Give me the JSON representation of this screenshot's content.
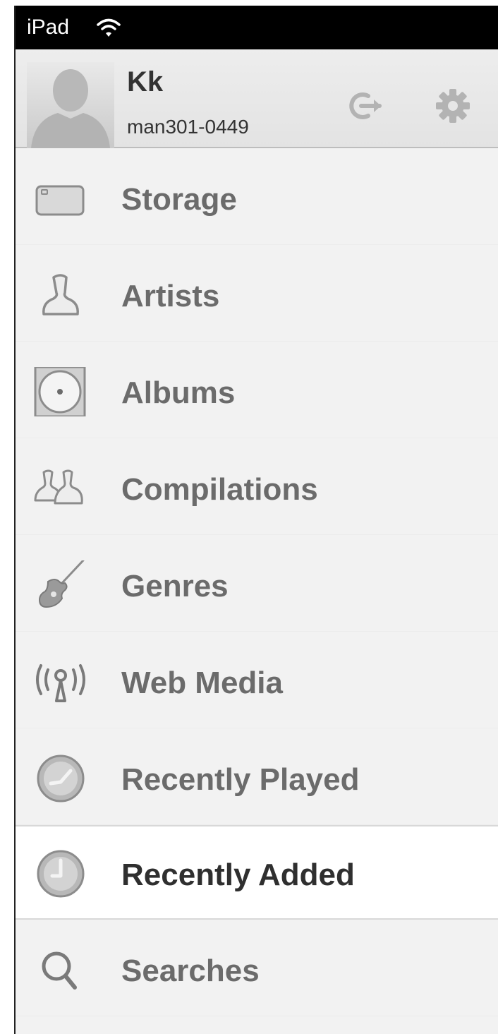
{
  "status_bar": {
    "device_name": "iPad",
    "wifi_icon": "wifi-icon"
  },
  "header": {
    "user_name": "Kk",
    "user_id": "man301-0449",
    "avatar_icon": "person-silhouette-icon",
    "logout_icon": "logout-arrow-icon",
    "settings_icon": "gear-icon"
  },
  "menu": {
    "items": [
      {
        "label": "Storage",
        "icon": "storage-drive-icon",
        "selected": false
      },
      {
        "label": "Artists",
        "icon": "artist-person-icon",
        "selected": false
      },
      {
        "label": "Albums",
        "icon": "album-disc-icon",
        "selected": false
      },
      {
        "label": "Compilations",
        "icon": "compilations-people-icon",
        "selected": false
      },
      {
        "label": "Genres",
        "icon": "guitar-icon",
        "selected": false
      },
      {
        "label": "Web Media",
        "icon": "broadcast-antenna-icon",
        "selected": false
      },
      {
        "label": "Recently Played",
        "icon": "clock-played-icon",
        "selected": false
      },
      {
        "label": "Recently Added",
        "icon": "clock-added-icon",
        "selected": true
      },
      {
        "label": "Searches",
        "icon": "search-icon",
        "selected": false
      }
    ]
  },
  "colors": {
    "background": "#f2f2f2",
    "selected_background": "#ffffff",
    "label_text": "#6b6b6b",
    "selected_label_text": "#2f2f2f",
    "icon_gray": "#8c8c8c"
  }
}
